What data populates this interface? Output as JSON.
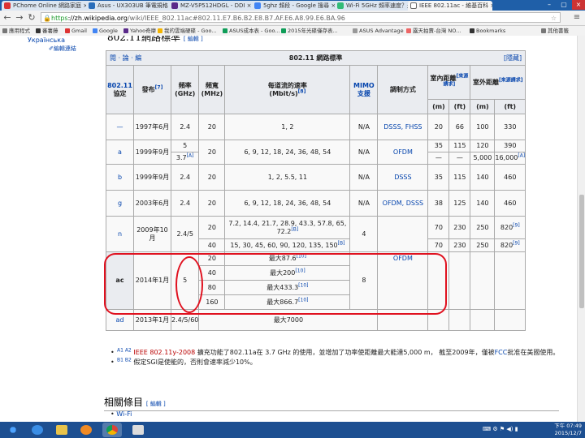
{
  "browser": {
    "tabs": [
      {
        "label": "PChome Online 網路家庭 ×",
        "color": "#d33"
      },
      {
        "label": "Asus - UX303UB 筆電規格 ×",
        "color": "#2a6ebb"
      },
      {
        "label": "MZ-V5P512HDGL - DDI ×",
        "color": "#5a2a8a"
      },
      {
        "label": "5ghz 頻段 - Google 搜尋 ×",
        "color": "#4285f4"
      },
      {
        "label": "Wi-Fi 5GHz 頻率速度？是 ×",
        "color": "#3b7"
      },
      {
        "label": "IEEE 802.11ac - 維基百科 ×",
        "color": "#666"
      }
    ],
    "url_https": "https",
    "url_host": "://zh.wikipedia.org",
    "url_path": "/wiki/IEEE_802.11ac#802.11.E7.B6.B2.E8.B7.AF.E6.A8.99.E6.BA.96",
    "bookmarks": [
      {
        "label": "應用程式",
        "color": "#777"
      },
      {
        "label": "蕃薯藤",
        "color": "#333"
      },
      {
        "label": "Gmail",
        "color": "#d33"
      },
      {
        "label": "Google",
        "color": "#4285f4"
      },
      {
        "label": "Yahoo奇摩",
        "color": "#5a2a8a"
      },
      {
        "label": "我的雲端硬碟 - Goo...",
        "color": "#f4b400"
      },
      {
        "label": "ASUS成本表 - Goo...",
        "color": "#0f9d58"
      },
      {
        "label": "2015年光碟僅存表...",
        "color": "#0f9d58"
      },
      {
        "label": "ASUS Advantage",
        "color": "#999"
      },
      {
        "label": "露天拍賣-台灣 NO...",
        "color": "#e66"
      },
      {
        "label": "Bookmarks",
        "color": "#333"
      },
      {
        "label": "其他書籤",
        "color": "#777"
      }
    ]
  },
  "sidebar": {
    "language": "Українська",
    "edit_links": "✐編輯連結"
  },
  "section_heading": "802.11網路標準",
  "section_edit": "[ 編輯 ]",
  "table": {
    "header_nav": "閱 · 論 · 編",
    "header_title": "802.11 網路標準",
    "header_hide": "[隱藏]",
    "col_protocol": "802.11",
    "col_protocol_2": "協定",
    "col_release": "發布",
    "col_release_sup": "[7]",
    "col_freq": "頻率",
    "col_freq_unit": "(GHz)",
    "col_bw": "頻寬",
    "col_bw_unit": "(MHz)",
    "col_rate": "每道流的速率",
    "col_rate_unit": "(Mbit/s)",
    "col_rate_sup": "[8]",
    "col_mimo": "MIMO 支援",
    "col_mod": "調制方式",
    "col_indoor": "室內距離",
    "col_indoor_sup": "[來源請求]",
    "col_outdoor": "室外距離",
    "col_outdoor_sup": "[來源請求]",
    "unit_m": "(m)",
    "unit_ft": "(ft)",
    "rows": {
      "dash": {
        "proto": "—",
        "release": "1997年6月",
        "freq": "2.4",
        "bw": "20",
        "rate": "1, 2",
        "mimo": "N/A",
        "mod": "DSSS, FHSS",
        "in_m": "20",
        "in_ft": "66",
        "out_m": "100",
        "out_ft": "330"
      },
      "a": {
        "proto": "a",
        "release": "1999年9月",
        "freq": "5",
        "freq2": "3.7",
        "freq2_sup": "[A]",
        "bw": "20",
        "rate": "6, 9, 12, 18, 24, 36, 48, 54",
        "mimo": "N/A",
        "mod": "OFDM",
        "in_m": "35",
        "in_ft": "115",
        "out_m": "120",
        "out_ft": "390",
        "in_m2": "—",
        "in_ft2": "—",
        "out_m2": "5,000",
        "out_ft2": "16,000",
        "out_ft2_sup": "[A]"
      },
      "b": {
        "proto": "b",
        "release": "1999年9月",
        "freq": "2.4",
        "bw": "20",
        "rate": "1, 2, 5.5, 11",
        "mimo": "N/A",
        "mod": "DSSS",
        "in_m": "35",
        "in_ft": "115",
        "out_m": "140",
        "out_ft": "460"
      },
      "g": {
        "proto": "g",
        "release": "2003年6月",
        "freq": "2.4",
        "bw": "20",
        "rate": "6, 9, 12, 18, 24, 36, 48, 54",
        "mimo": "N/A",
        "mod": "OFDM, DSSS",
        "in_m": "38",
        "in_ft": "125",
        "out_m": "140",
        "out_ft": "460"
      },
      "n": {
        "proto": "n",
        "release": "2009年10月",
        "freq": "2.4/5",
        "bw": "20",
        "bw2": "40",
        "rate": "7.2, 14.4, 21.7, 28.9, 43.3, 57.8, 65, 72.2",
        "rate_sup": "[B]",
        "rate2": "15, 30, 45, 60, 90, 120, 135, 150",
        "rate2_sup": "[B]",
        "mimo": "4",
        "in_m": "70",
        "in_ft": "230",
        "out_m": "250",
        "out_ft": "820",
        "out_ft_sup": "[9]",
        "in_m2": "70",
        "in_ft2": "230",
        "out_m2": "250",
        "out_ft2": "820",
        "out_ft2_sup": "[9]"
      },
      "ac": {
        "proto": "ac",
        "release": "2014年1月",
        "freq": "5",
        "bw": [
          "20",
          "40",
          "80",
          "160"
        ],
        "rate": [
          "最大87.6",
          "最大200",
          "最大433.3",
          "最大866.7"
        ],
        "rate_sup": "[10]",
        "mimo": "8",
        "mod": "OFDM"
      },
      "ad": {
        "proto": "ad",
        "release": "2013年1月",
        "freq": "2.4/5/60",
        "rate": "最大7000"
      }
    }
  },
  "notes": {
    "a_tag": "A1 A2",
    "a_link": "IEEE 802.11y-2008",
    "a_text_1": "擴充功能了802.11a在 3.7 GHz 的使用，並增加了功率使距離最大能達5,000 m， 截至2009年，僅被",
    "a_link2": "FCC",
    "a_text_2": "批准在美國使用。",
    "b_tag": "B1 B2",
    "b_text": "假定SGI是使能的，否則會速率減少10%。"
  },
  "related": {
    "heading": "相關條目",
    "edit": "[ 編輯 ]",
    "wifi": "Wi-Fi"
  },
  "taskbar": {
    "time": "下午 07:49",
    "date": "2015/12/7"
  }
}
